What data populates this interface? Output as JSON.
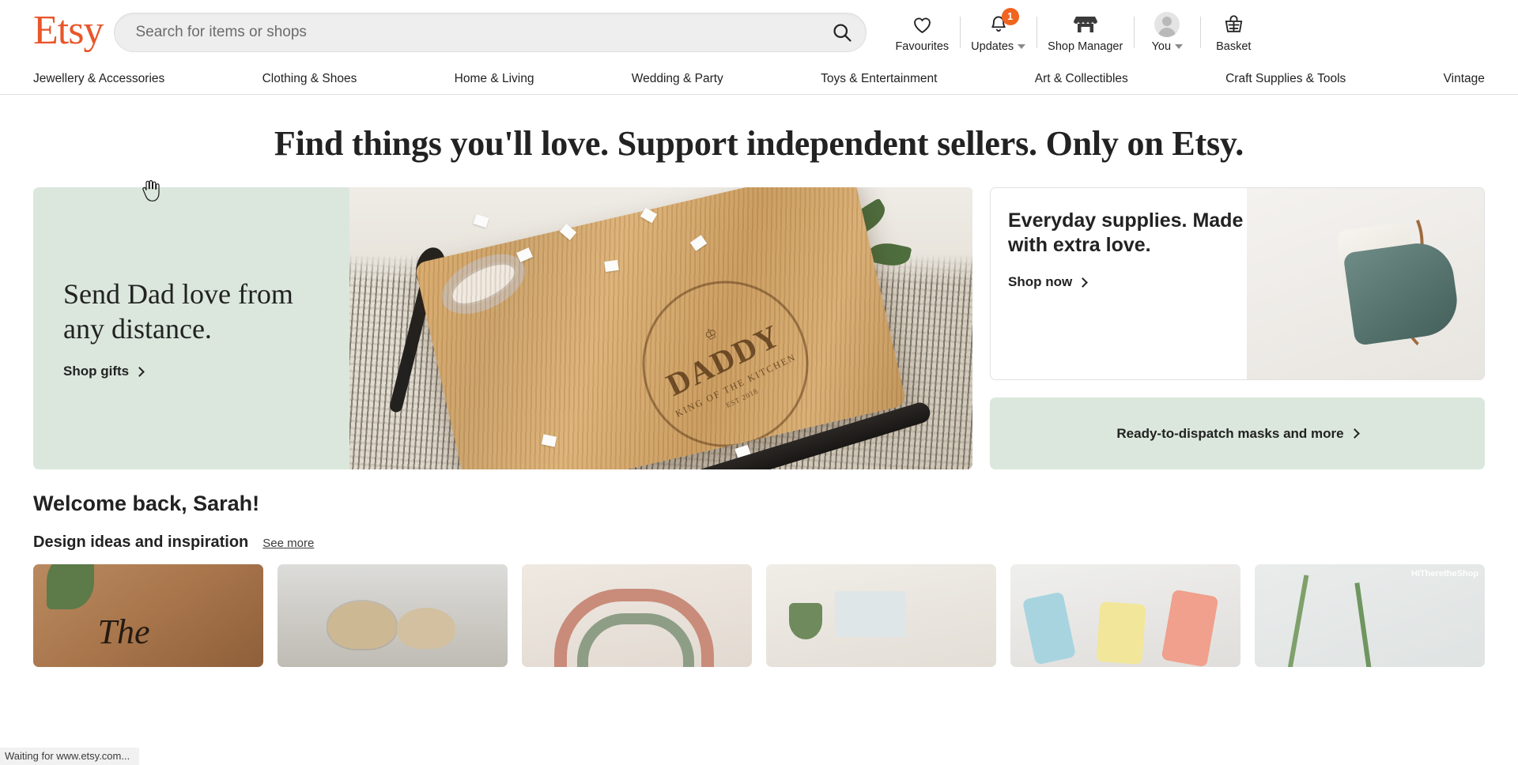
{
  "header": {
    "logo": "Etsy",
    "search": {
      "placeholder": "Search for items or shops",
      "value": "",
      "icon": "search-icon"
    },
    "actions": [
      {
        "label": "Favourites",
        "icon": "heart-icon",
        "badge": null,
        "caret": false
      },
      {
        "label": "Updates",
        "icon": "bell-icon",
        "badge": "1",
        "caret": true
      },
      {
        "label": "Shop Manager",
        "icon": "storefront-icon",
        "badge": null,
        "caret": false
      },
      {
        "label": "You",
        "icon": "avatar-icon",
        "badge": null,
        "caret": true
      },
      {
        "label": "Basket",
        "icon": "basket-icon",
        "badge": null,
        "caret": false
      }
    ]
  },
  "nav": {
    "items": [
      "Jewellery & Accessories",
      "Clothing & Shoes",
      "Home & Living",
      "Wedding & Party",
      "Toys & Entertainment",
      "Art & Collectibles",
      "Craft Supplies & Tools",
      "Vintage"
    ]
  },
  "hero": {
    "headline": "Find things you'll love. Support independent sellers. Only on Etsy."
  },
  "promos": {
    "left": {
      "title": "Send Dad love from any distance.",
      "cta": "Shop gifts",
      "background_color": "#dbe7dc",
      "image_caption": "DADDY KING OF THE KITCHEN EST 2018",
      "stamp": {
        "main": "DADDY",
        "sub": "KING OF THE KITCHEN",
        "est": "EST 2018"
      }
    },
    "supplies": {
      "title": "Everyday supplies. Made with extra love.",
      "cta": "Shop now"
    },
    "ready": {
      "label": "Ready-to-dispatch masks and more",
      "background_color": "#dbe7dc"
    }
  },
  "main": {
    "welcome": "Welcome back, Sarah!",
    "section_title": "Design ideas and inspiration",
    "see_more": "See more",
    "thumbnails": [
      {
        "name": "doormat-thumb",
        "watermark": ""
      },
      {
        "name": "pendant-lamps-thumb",
        "watermark": ""
      },
      {
        "name": "macrame-rainbow-thumb",
        "watermark": ""
      },
      {
        "name": "succulent-box-thumb",
        "watermark": ""
      },
      {
        "name": "pastel-candles-thumb",
        "watermark": ""
      },
      {
        "name": "plant-stems-thumb",
        "watermark": "HITheretheShop"
      }
    ]
  },
  "statusbar": {
    "text": "Waiting for www.etsy.com..."
  },
  "colors": {
    "brand_orange": "#e8562a",
    "badge_orange": "#f1641e",
    "promo_green": "#dbe7dc",
    "text_dark": "#222222"
  }
}
